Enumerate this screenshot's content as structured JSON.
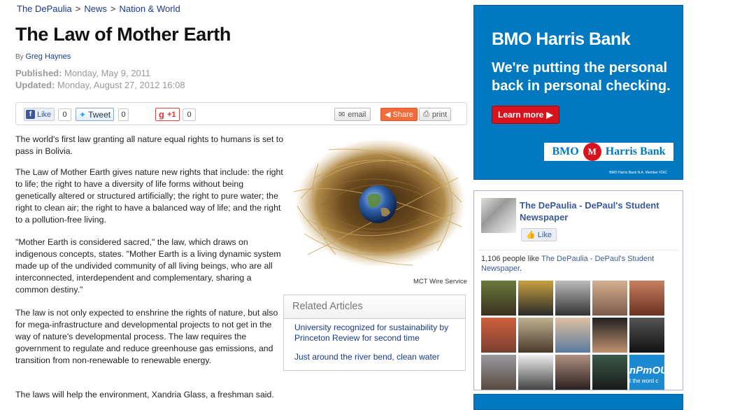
{
  "breadcrumb": {
    "items": [
      "The DePaulia",
      "News",
      "Nation & World"
    ],
    "separator": ">"
  },
  "article": {
    "title": "The Law of Mother Earth",
    "by_label": "By",
    "author": "Greg Haynes",
    "published_label": "Published:",
    "published": "Monday, May 9, 2011",
    "updated_label": "Updated:",
    "updated": "Monday, August 27, 2012 16:08",
    "paragraphs": [
      "The world's first law granting all nature equal rights to humans is set to pass in Bolivia.",
      "The Law of Mother Earth gives nature new rights that include: the right to life; the right to have a diversity of life forms without being genetically altered or structured artificially; the right to pure water; the right to clean air; the right to have a balanced way of life; and the right to a pollution-free living.",
      "\"Mother Earth is considered sacred,\" the law, which draws on indigenous concepts, states. \"Mother Earth is a living dynamic system made up of the undivided community of all living beings, who are all interconnected, interdependent and complementary, sharing a common destiny.\"",
      "The law is not only expected to enshrine the rights of nature, but also for mega-infrastructure and developmental projects to not get in the way of nature's developmental process. The law requires the government to regulate and reduce greenhouse gas emissions, and transition from non-renewable to renewable energy.",
      "The laws will help the environment, Xandria Glass, a freshman said."
    ],
    "photo_caption": "MCT Wire Service"
  },
  "sharebar": {
    "fb_like_label": "Like",
    "fb_count": "0",
    "tweet_label": "Tweet",
    "tweet_count": "0",
    "gplus_label": "+1",
    "gplus_count": "0",
    "email_label": "email",
    "share_label": "Share",
    "print_label": "print"
  },
  "related": {
    "header": "Related Articles",
    "links": [
      "University recognized for sustainability by Princeton Review for second time",
      "Just around the river bend, clean water"
    ]
  },
  "ad": {
    "bank_name": "BMO Harris Bank",
    "tagline": "We're putting the personal back in personal checking.",
    "cta": "Learn more",
    "logo_left": "BMO",
    "logo_right": "Harris Bank",
    "fine_print": "BMO Harris Bank N.A. Member FDIC",
    "colors": {
      "background": "#0079c1",
      "cta": "#d7131d"
    }
  },
  "facebook_box": {
    "page_name": "The DePaulia - DePaul's Student Newspaper",
    "like_label": "Like",
    "count_text": "1,106 people like",
    "count_link": "The DePaulia - DePaul's Student Newspaper",
    "face_tile_text": "nPmOU",
    "face_tile_subtext": "t the word c"
  }
}
